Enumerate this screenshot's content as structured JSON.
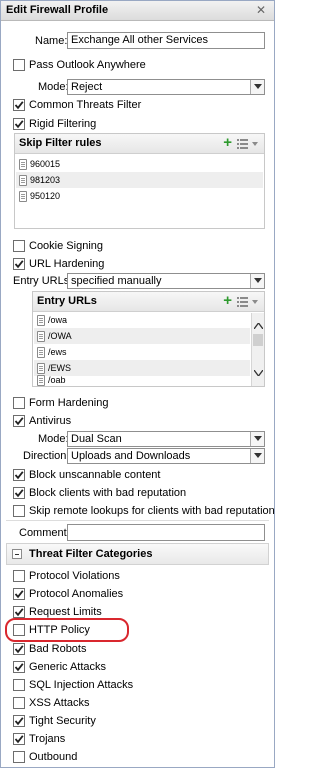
{
  "window": {
    "title": "Edit Firewall Profile",
    "close_glyph": "✕"
  },
  "name": {
    "label": "Name:",
    "value": "Exchange All other Services"
  },
  "pass_outlook": {
    "label": "Pass Outlook Anywhere",
    "checked": false
  },
  "mode": {
    "label": "Mode:",
    "value": "Reject"
  },
  "common_threats": {
    "label": "Common Threats Filter",
    "checked": true
  },
  "rigid_filtering": {
    "label": "Rigid Filtering",
    "checked": true
  },
  "skip_filter": {
    "title": "Skip Filter rules",
    "add_glyph": "+",
    "rows": [
      "960015",
      "981203",
      "950120"
    ]
  },
  "cookie_signing": {
    "label": "Cookie Signing",
    "checked": false
  },
  "url_hardening": {
    "label": "URL Hardening",
    "checked": true
  },
  "entry_urls_select": {
    "label": "Entry URLs:",
    "value": "specified manually"
  },
  "entry_urls": {
    "title": "Entry URLs",
    "add_glyph": "+",
    "rows": [
      "/owa",
      "/OWA",
      "/ews",
      "/EWS",
      "/oab"
    ]
  },
  "form_hardening": {
    "label": "Form Hardening",
    "checked": false
  },
  "antivirus": {
    "label": "Antivirus",
    "checked": true
  },
  "av_mode": {
    "label": "Mode:",
    "value": "Dual Scan"
  },
  "direction": {
    "label": "Direction:",
    "value": "Uploads and Downloads"
  },
  "block_unscannable": {
    "label": "Block unscannable content",
    "checked": true
  },
  "block_bad_rep": {
    "label": "Block clients with bad reputation",
    "checked": true
  },
  "skip_remote": {
    "label": "Skip remote lookups for clients with bad reputation",
    "checked": false
  },
  "comment": {
    "label": "Comment:",
    "value": ""
  },
  "threat_categories": {
    "title": "Threat Filter Categories",
    "items": [
      {
        "label": "Protocol Violations",
        "checked": false
      },
      {
        "label": "Protocol Anomalies",
        "checked": true
      },
      {
        "label": "Request Limits",
        "checked": true
      },
      {
        "label": "HTTP Policy",
        "checked": false
      },
      {
        "label": "Bad Robots",
        "checked": true
      },
      {
        "label": "Generic Attacks",
        "checked": true
      },
      {
        "label": "SQL Injection Attacks",
        "checked": false
      },
      {
        "label": "XSS Attacks",
        "checked": false
      },
      {
        "label": "Tight Security",
        "checked": true
      },
      {
        "label": "Trojans",
        "checked": true
      },
      {
        "label": "Outbound",
        "checked": false
      }
    ]
  },
  "colors": {
    "accent_add": "#2e9a2e",
    "highlight": "#d9272e",
    "border": "#99a8c3"
  }
}
